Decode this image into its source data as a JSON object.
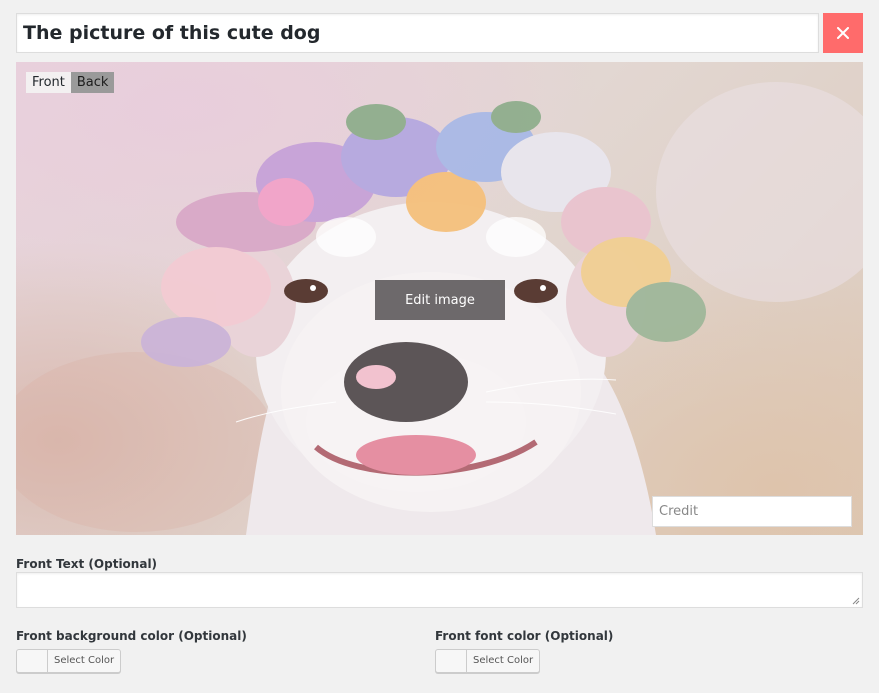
{
  "title": {
    "value": "The picture of this cute dog"
  },
  "close_button": {
    "icon": "close-icon",
    "color": "#ff6b6b"
  },
  "image_panel": {
    "face_toggle": {
      "front_label": "Front",
      "back_label": "Back"
    },
    "edit_button_label": "Edit image",
    "credit": {
      "placeholder": "Credit",
      "value": ""
    }
  },
  "front_text": {
    "label": "Front Text (Optional)",
    "value": ""
  },
  "front_background_color": {
    "label": "Front background color (Optional)",
    "button_label": "Select Color"
  },
  "front_font_color": {
    "label": "Front font color (Optional)",
    "button_label": "Select Color"
  }
}
